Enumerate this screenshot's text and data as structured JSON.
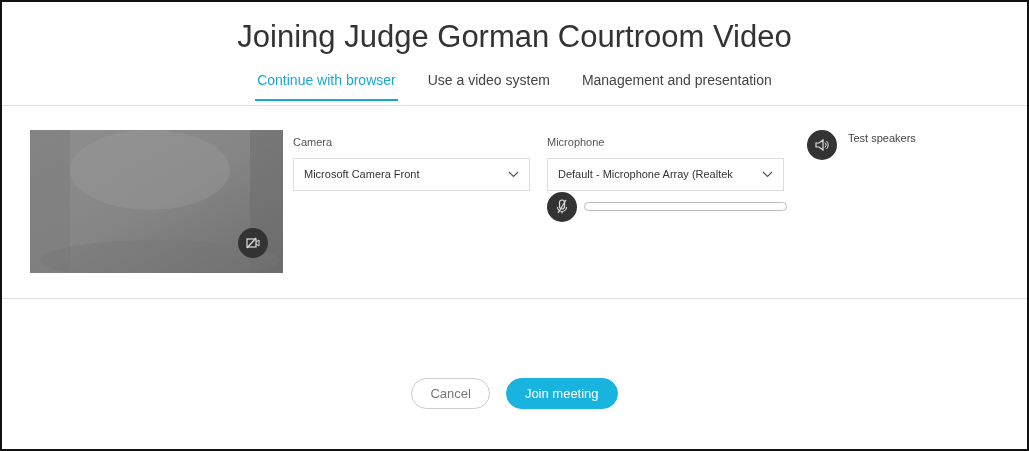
{
  "title": "Joining Judge Gorman Courtroom Video",
  "tabs": [
    {
      "label": "Continue with browser",
      "selected": true
    },
    {
      "label": "Use a video system",
      "selected": false
    },
    {
      "label": "Management and presentation",
      "selected": false
    }
  ],
  "camera": {
    "label": "Camera",
    "value": "Microsoft Camera Front"
  },
  "microphone": {
    "label": "Microphone",
    "value": "Default - Microphone Array (Realtek",
    "level": 0
  },
  "speakers": {
    "label": "Test speakers"
  },
  "buttons": [
    {
      "label": "Cancel",
      "kind": "secondary"
    },
    {
      "label": "Join meeting",
      "kind": "primary"
    }
  ]
}
